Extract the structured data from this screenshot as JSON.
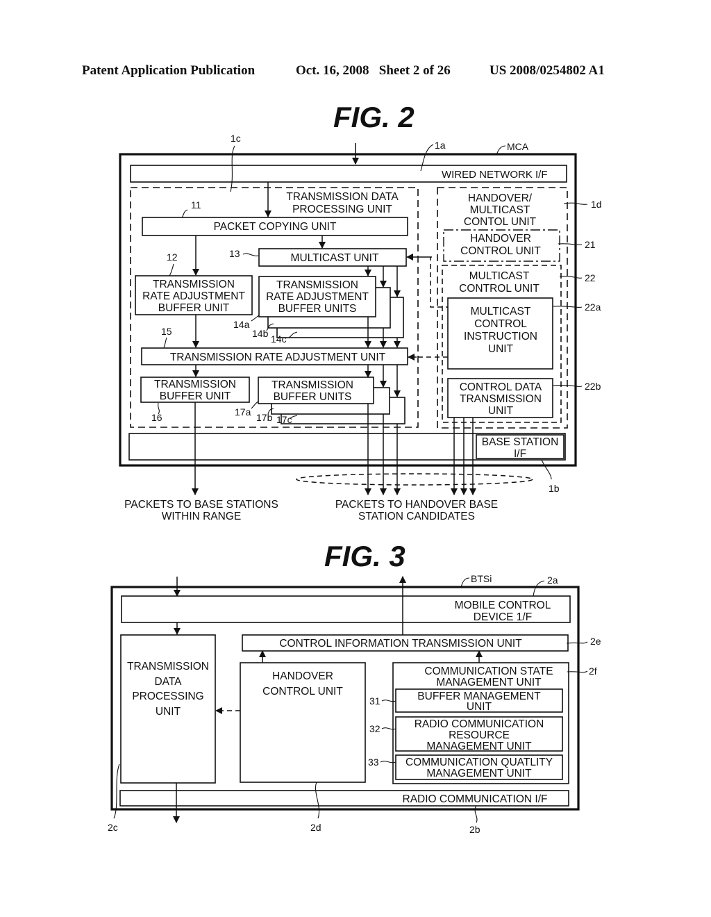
{
  "header": {
    "publication": "Patent Application Publication",
    "date_sheet": "Oct. 16, 2008   Sheet 2 of 26",
    "number": "US 2008/0254802 A1"
  },
  "fig2": {
    "title": "FIG. 2",
    "refs": {
      "mca": "MCA",
      "r1a": "1a",
      "r1b": "1b",
      "r1c": "1c",
      "r1d": "1d",
      "r11": "11",
      "r12": "12",
      "r13": "13",
      "r14a": "14a",
      "r14b": "14b",
      "r14c": "14c",
      "r15": "15",
      "r16": "16",
      "r17a": "17a",
      "r17b": "17b",
      "r17c": "17c",
      "r21": "21",
      "r22": "22",
      "r22a": "22a",
      "r22b": "22b"
    },
    "wired_network_if": "WIRED NETWORK I/F",
    "tdp_unit": [
      "TRANSMISSION DATA",
      "PROCESSING UNIT"
    ],
    "packet_copying_unit": "PACKET COPYING UNIT",
    "multicast_unit": "MULTICAST UNIT",
    "rate_adj_buffer_unit": [
      "TRANSMISSION",
      "RATE ADJUSTMENT",
      "BUFFER UNIT"
    ],
    "rate_adj_buffer_units": [
      "TRANSMISSION",
      "RATE ADJUSTMENT",
      "BUFFER UNITS"
    ],
    "rate_adj_unit": "TRANSMISSION RATE ADJUSTMENT UNIT",
    "tx_buffer_unit": [
      "TRANSMISSION",
      "BUFFER UNIT"
    ],
    "tx_buffer_units": [
      "TRANSMISSION",
      "BUFFER UNITS"
    ],
    "handover_multicast_control": [
      "HANDOVER/",
      "MULTICAST",
      "CONTOL UNIT"
    ],
    "handover_control_unit": [
      "HANDOVER",
      "CONTROL UNIT"
    ],
    "multicast_control_unit": [
      "MULTICAST",
      "CONTROL UNIT"
    ],
    "multicast_control_instruction": [
      "MULTICAST",
      "CONTROL",
      "INSTRUCTION",
      "UNIT"
    ],
    "control_data_transmission": [
      "CONTROL DATA",
      "TRANSMISSION",
      "UNIT"
    ],
    "base_station_if": [
      "BASE STATION",
      "I/F"
    ],
    "packets_in_range": [
      "PACKETS TO BASE STATIONS",
      "WITHIN RANGE"
    ],
    "packets_handover": [
      "PACKETS TO HANDOVER BASE",
      "STATION CANDIDATES"
    ]
  },
  "fig3": {
    "title": "FIG. 3",
    "refs": {
      "btsi": "BTSi",
      "r2a": "2a",
      "r2b": "2b",
      "r2c": "2c",
      "r2d": "2d",
      "r2e": "2e",
      "r2f": "2f",
      "r31": "31",
      "r32": "32",
      "r33": "33"
    },
    "mobile_control_if": [
      "MOBILE CONTROL",
      "DEVICE 1/F"
    ],
    "control_info_tx_unit": "CONTROL INFORMATION TRANSMISSION UNIT",
    "tdp_unit": [
      "TRANSMISSION",
      "DATA",
      "PROCESSING",
      "UNIT"
    ],
    "handover_control_unit": [
      "HANDOVER",
      "CONTROL UNIT"
    ],
    "comm_state_mgmt": [
      "COMMUNICATION STATE",
      "MANAGEMENT UNIT"
    ],
    "buffer_mgmt": [
      "BUFFER MANAGEMENT",
      "UNIT"
    ],
    "radio_resource_mgmt": [
      "RADIO COMMUNICATION",
      "RESOURCE",
      "MANAGEMENT UNIT"
    ],
    "comm_quality_mgmt": [
      "COMMUNICATION QUATLITY",
      "MANAGEMENT UNIT"
    ],
    "radio_comm_if": "RADIO COMMUNICATION I/F"
  }
}
